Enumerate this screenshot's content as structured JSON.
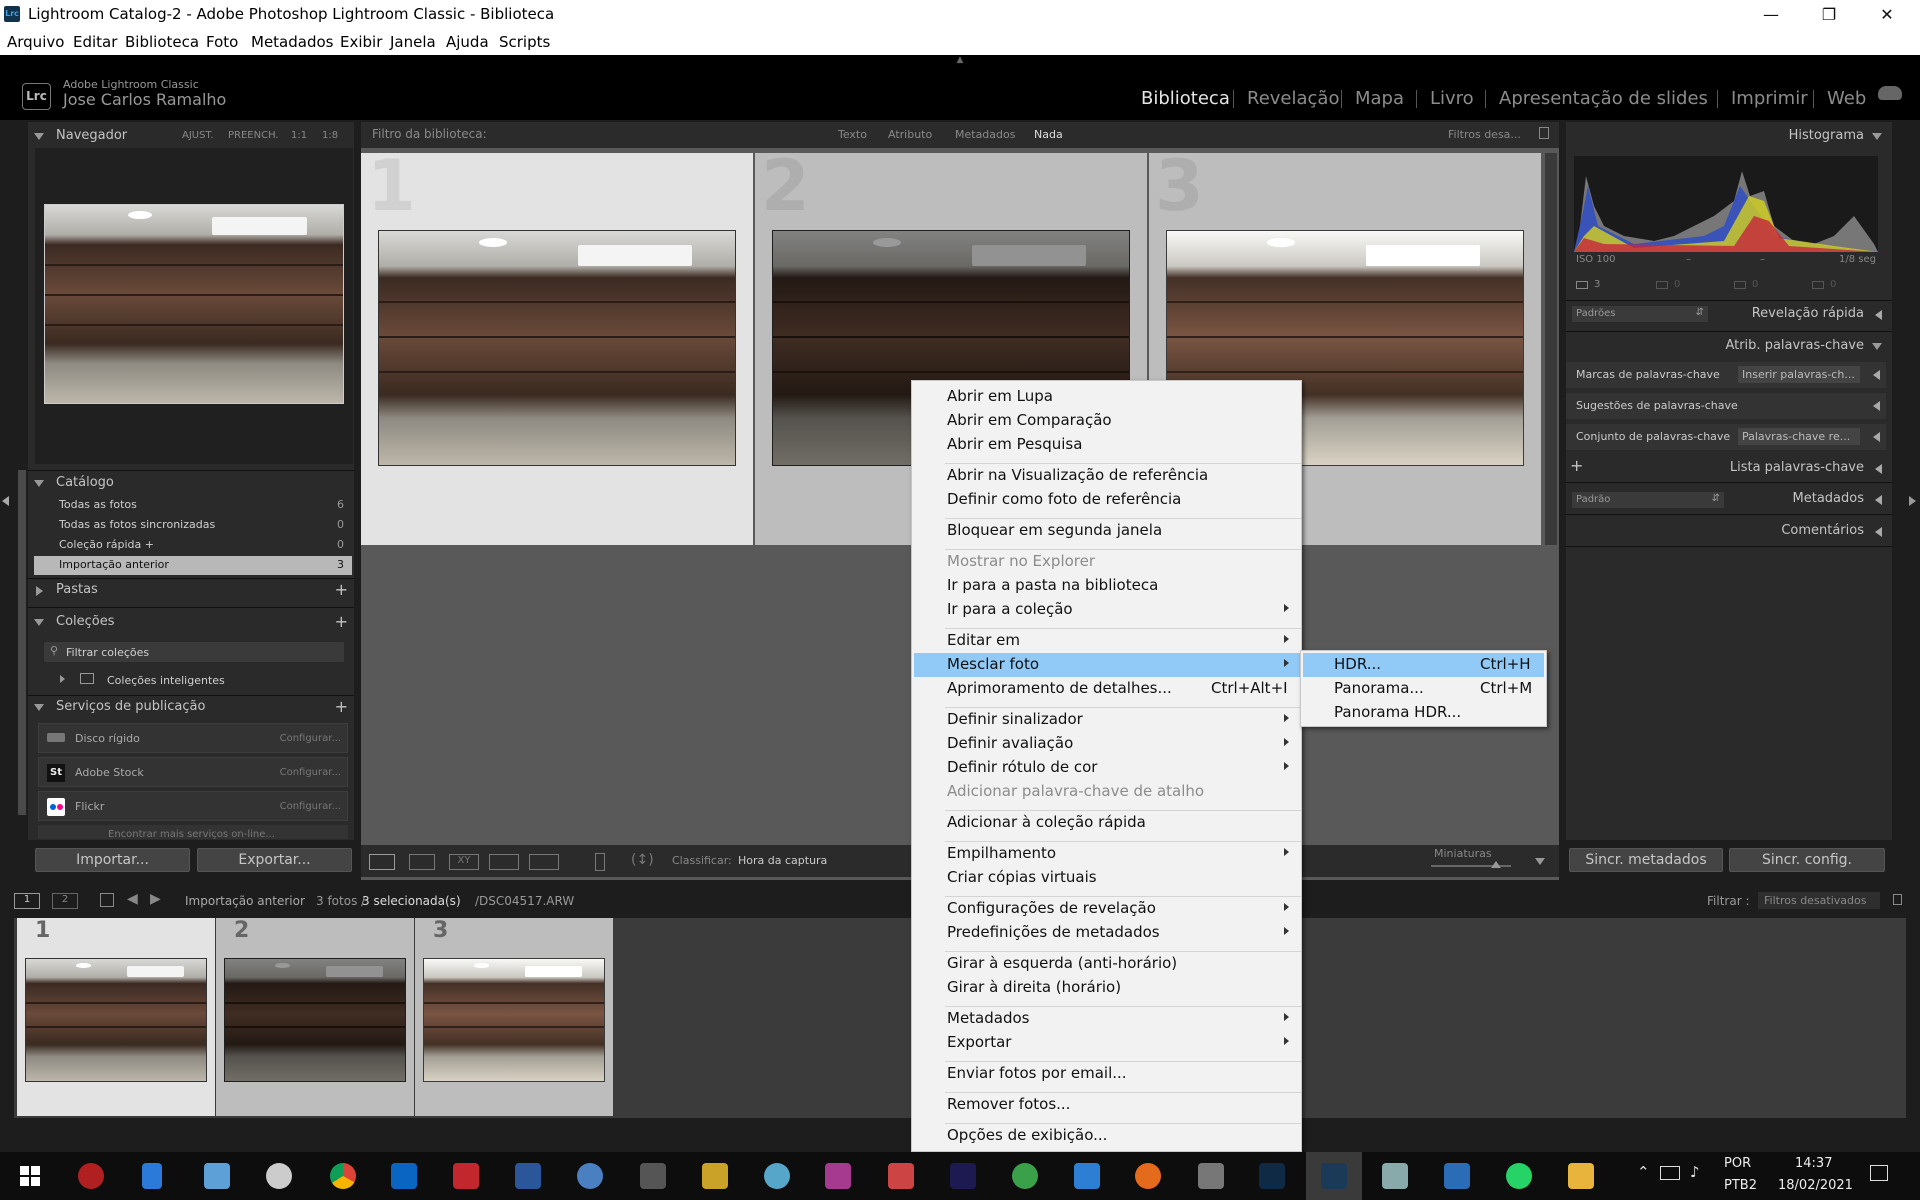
{
  "window": {
    "title": "Lightroom Catalog-2 - Adobe Photoshop Lightroom Classic - Biblioteca",
    "app_icon": "Lrc"
  },
  "menubar": [
    "Arquivo",
    "Editar",
    "Biblioteca",
    "Foto",
    "Metadados",
    "Exibir",
    "Janela",
    "Ajuda",
    "Scripts"
  ],
  "identity": {
    "badge": "Lrc",
    "app": "Adobe Lightroom Classic",
    "user": "Jose Carlos Ramalho"
  },
  "modules": [
    "Biblioteca",
    "Revelação",
    "Mapa",
    "Livro",
    "Apresentação de slides",
    "Imprimir",
    "Web"
  ],
  "navigator": {
    "title": "Navegador",
    "zoom": [
      "AJUST.",
      "PREENCH.",
      "1:1",
      "1:8"
    ]
  },
  "catalog": {
    "title": "Catálogo",
    "items": [
      {
        "label": "Todas as fotos",
        "count": "6"
      },
      {
        "label": "Todas as fotos sincronizadas",
        "count": "0"
      },
      {
        "label": "Coleção rápida +",
        "count": "0"
      },
      {
        "label": "Importação anterior",
        "count": "3"
      }
    ]
  },
  "folders": {
    "title": "Pastas"
  },
  "collections": {
    "title": "Coleções",
    "filter": "Filtrar coleções",
    "smart": "Coleções inteligentes"
  },
  "publish": {
    "title": "Serviços de publicação",
    "items": [
      {
        "label": "Disco rígido",
        "action": "Configurar..."
      },
      {
        "label": "Adobe Stock",
        "action": "Configurar..."
      },
      {
        "label": "Flickr",
        "action": "Configurar..."
      }
    ],
    "more": "Encontrar mais serviços on-line..."
  },
  "buttons": {
    "import": "Importar...",
    "export": "Exportar...",
    "sync_meta": "Sincr. metadados",
    "sync_config": "Sincr. config."
  },
  "filterbar": {
    "label": "Filtro da biblioteca:",
    "tabs": [
      "Texto",
      "Atributo",
      "Metadados",
      "Nada"
    ],
    "active": "Nada",
    "preset": "Filtros desa..."
  },
  "grid": {
    "cells": [
      "1",
      "2",
      "3"
    ]
  },
  "toolbar": {
    "sort_label": "Classificar:",
    "sort_value": "Hora da captura",
    "thumbs_label": "Miniaturas"
  },
  "right_panel": {
    "histogram": "Histograma",
    "exif": {
      "iso": "ISO 100",
      "dash1": "–",
      "dash2": "–",
      "shutter": "1/8 seg"
    },
    "hist_counts": [
      "3",
      "0",
      "0",
      "0"
    ],
    "quick_develop": "Revelação rápida",
    "quick_preset": "Padrões",
    "keywording": "Atrib. palavras-chave",
    "kw_tags_label": "Marcas de palavras-chave",
    "kw_tags_value": "Inserir palavras-ch...",
    "kw_suggestions": "Sugestões de palavras-chave",
    "kw_set_label": "Conjunto de palavras-chave",
    "kw_set_value": "Palavras-chave re...",
    "keyword_list": "Lista palavras-chave",
    "metadata_preset": "Padrão",
    "metadata": "Metadados",
    "comments": "Comentários"
  },
  "filmstrip": {
    "pages": [
      "1",
      "2"
    ],
    "source": "Importação anterior",
    "count": "3 fotos /",
    "selected": "3 selecionada(s)",
    "file": "/DSC04517.ARW",
    "filter_label": "Filtrar :",
    "filter_value": "Filtros desativados",
    "cells": [
      "1",
      "2",
      "3"
    ]
  },
  "context_menu": [
    {
      "label": "Abrir em Lupa"
    },
    {
      "label": "Abrir em Comparação"
    },
    {
      "label": "Abrir em Pesquisa"
    },
    {
      "label": "Abrir na Visualização de referência"
    },
    {
      "label": "Definir como foto de referência"
    },
    {
      "label": "Bloquear em segunda janela"
    },
    {
      "label": "Mostrar no Explorer"
    },
    {
      "label": "Ir para a pasta na biblioteca"
    },
    {
      "label": "Ir para a coleção"
    },
    {
      "label": "Editar em"
    },
    {
      "label": "Mesclar foto"
    },
    {
      "label": "Aprimoramento de detalhes...",
      "shortcut": "Ctrl+Alt+I"
    },
    {
      "label": "Definir sinalizador"
    },
    {
      "label": "Definir avaliação"
    },
    {
      "label": "Definir rótulo de cor"
    },
    {
      "label": "Adicionar palavra-chave de atalho"
    },
    {
      "label": "Adicionar à coleção rápida"
    },
    {
      "label": "Empilhamento"
    },
    {
      "label": "Criar cópias virtuais"
    },
    {
      "label": "Configurações de revelação"
    },
    {
      "label": "Predefinições de metadados"
    },
    {
      "label": "Girar à esquerda (anti-horário)"
    },
    {
      "label": "Girar à direita (horário)"
    },
    {
      "label": "Metadados"
    },
    {
      "label": "Exportar"
    },
    {
      "label": "Enviar fotos por email..."
    },
    {
      "label": "Remover fotos..."
    },
    {
      "label": "Opções de exibição..."
    }
  ],
  "submenu": [
    {
      "label": "HDR...",
      "shortcut": "Ctrl+H"
    },
    {
      "label": "Panorama...",
      "shortcut": "Ctrl+M"
    },
    {
      "label": "Panorama HDR..."
    }
  ],
  "taskbar": {
    "lang1": "POR",
    "lang2": "PTB2",
    "time": "14:37",
    "date": "18/02/2021"
  },
  "colors": {
    "menu_highlight": "#91c9f7",
    "panel_bg": "#2a2a2a",
    "selected_row": "#b8b8b8"
  }
}
